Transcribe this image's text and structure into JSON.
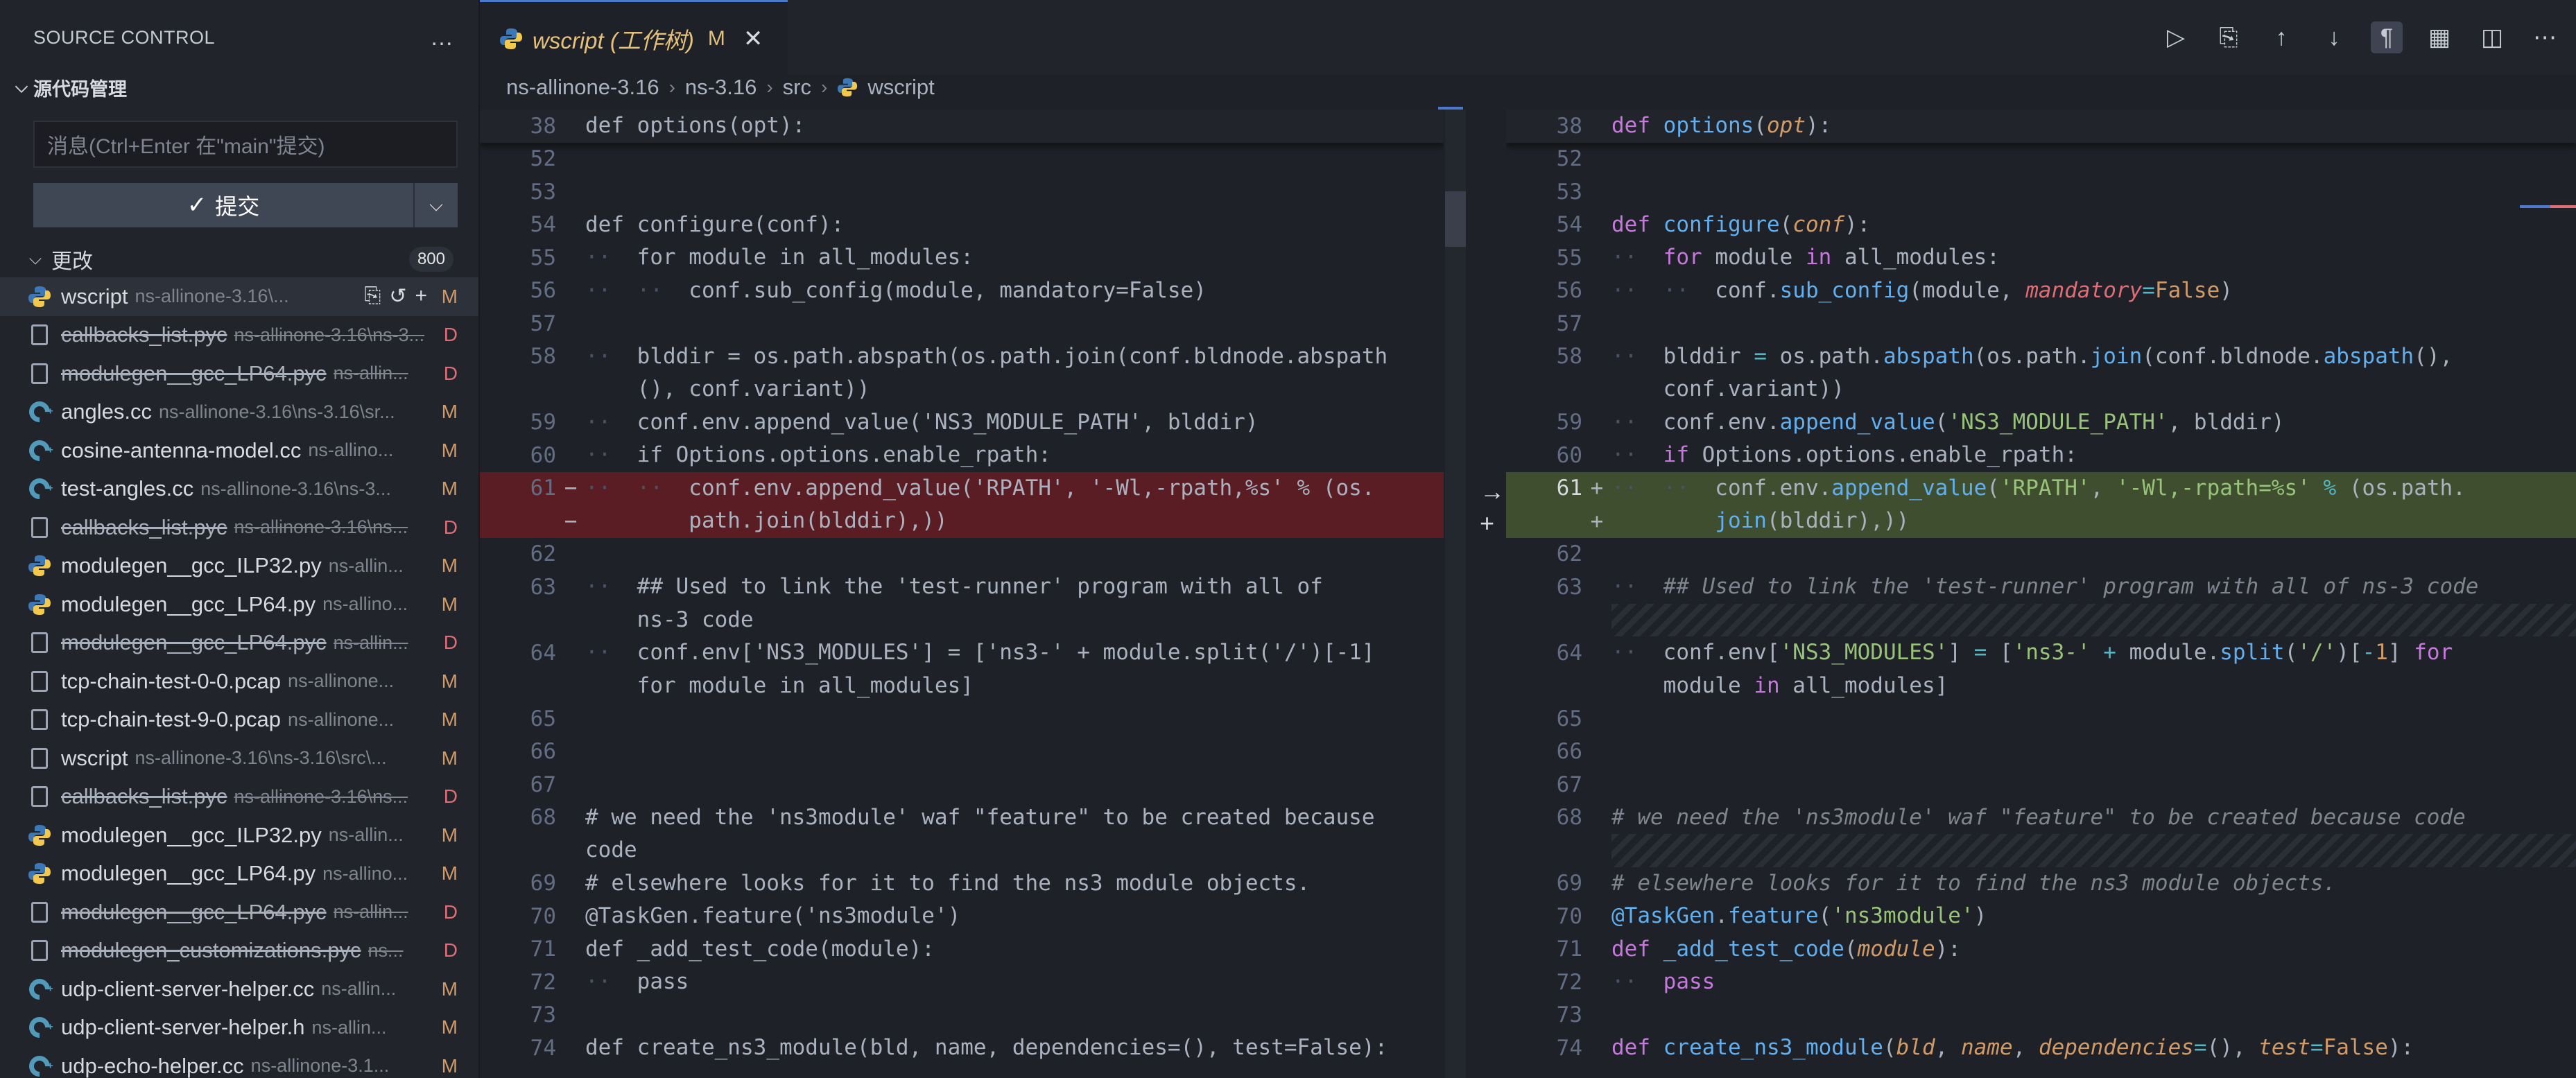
{
  "sidebar": {
    "title": "SOURCE CONTROL",
    "more_icon": "…",
    "section_title": "源代码管理",
    "commit_placeholder": "消息(Ctrl+Enter 在\"main\"提交)",
    "commit_label": "提交",
    "changes_label": "更改",
    "changes_count": "800",
    "files": [
      {
        "name": "wscript",
        "path": "ns-allinone-3.16\\...",
        "status": "M",
        "icon": "python-icon",
        "deleted": false,
        "active": true
      },
      {
        "name": "callbacks_list.pyc",
        "path": "ns-allinone-3.16\\ns-3...",
        "status": "D",
        "icon": "file-icon",
        "deleted": true
      },
      {
        "name": "modulegen__gcc_LP64.pyc",
        "path": "ns-allin...",
        "status": "D",
        "icon": "file-icon",
        "deleted": true
      },
      {
        "name": "angles.cc",
        "path": "ns-allinone-3.16\\ns-3.16\\sr...",
        "status": "M",
        "icon": "cpp-icon",
        "deleted": false
      },
      {
        "name": "cosine-antenna-model.cc",
        "path": "ns-allino...",
        "status": "M",
        "icon": "cpp-icon",
        "deleted": false
      },
      {
        "name": "test-angles.cc",
        "path": "ns-allinone-3.16\\ns-3...",
        "status": "M",
        "icon": "cpp-icon",
        "deleted": false
      },
      {
        "name": "callbacks_list.pyc",
        "path": "ns-allinone-3.16\\ns...",
        "status": "D",
        "icon": "file-icon",
        "deleted": true
      },
      {
        "name": "modulegen__gcc_ILP32.py",
        "path": "ns-allin...",
        "status": "M",
        "icon": "python-icon",
        "deleted": false
      },
      {
        "name": "modulegen__gcc_LP64.py",
        "path": "ns-allino...",
        "status": "M",
        "icon": "python-icon",
        "deleted": false
      },
      {
        "name": "modulegen__gcc_LP64.pyc",
        "path": "ns-allin...",
        "status": "D",
        "icon": "file-icon",
        "deleted": true
      },
      {
        "name": "tcp-chain-test-0-0.pcap",
        "path": "ns-allinone...",
        "status": "M",
        "icon": "file-icon",
        "deleted": false
      },
      {
        "name": "tcp-chain-test-9-0.pcap",
        "path": "ns-allinone...",
        "status": "M",
        "icon": "file-icon",
        "deleted": false
      },
      {
        "name": "wscript",
        "path": "ns-allinone-3.16\\ns-3.16\\src\\...",
        "status": "M",
        "icon": "file-icon",
        "deleted": false
      },
      {
        "name": "callbacks_list.pyc",
        "path": "ns-allinone-3.16\\ns...",
        "status": "D",
        "icon": "file-icon",
        "deleted": true
      },
      {
        "name": "modulegen__gcc_ILP32.py",
        "path": "ns-allin...",
        "status": "M",
        "icon": "python-icon",
        "deleted": false
      },
      {
        "name": "modulegen__gcc_LP64.py",
        "path": "ns-allino...",
        "status": "M",
        "icon": "python-icon",
        "deleted": false
      },
      {
        "name": "modulegen__gcc_LP64.pyc",
        "path": "ns-allin...",
        "status": "D",
        "icon": "file-icon",
        "deleted": true
      },
      {
        "name": "modulegen_customizations.pyc",
        "path": "ns...",
        "status": "D",
        "icon": "file-icon",
        "deleted": true
      },
      {
        "name": "udp-client-server-helper.cc",
        "path": "ns-allin...",
        "status": "M",
        "icon": "cpp-icon",
        "deleted": false
      },
      {
        "name": "udp-client-server-helper.h",
        "path": "ns-allin...",
        "status": "M",
        "icon": "cpp-icon",
        "deleted": false
      },
      {
        "name": "udp-echo-helper.cc",
        "path": "ns-allinone-3.1...",
        "status": "M",
        "icon": "cpp-icon",
        "deleted": false
      }
    ]
  },
  "editor": {
    "tab_title": "wscript (工作树)",
    "tab_status": "M",
    "tab_close": "✕",
    "breadcrumb": [
      "ns-allinone-3.16",
      "ns-3.16",
      "src",
      "wscript"
    ],
    "toolbar_icons": [
      "run-icon",
      "open-file-icon",
      "prev-change-icon",
      "next-change-icon",
      "whitespace-icon",
      "map-icon",
      "split-editor-icon",
      "more-icon"
    ],
    "mid_actions": [
      "→",
      "+"
    ]
  },
  "colors": {
    "accent": "#4d78cc",
    "modified": "#d19a66",
    "deleted": "#e06c75",
    "diff_removed": "#5a1d24",
    "diff_added": "#3e4e2e"
  }
}
